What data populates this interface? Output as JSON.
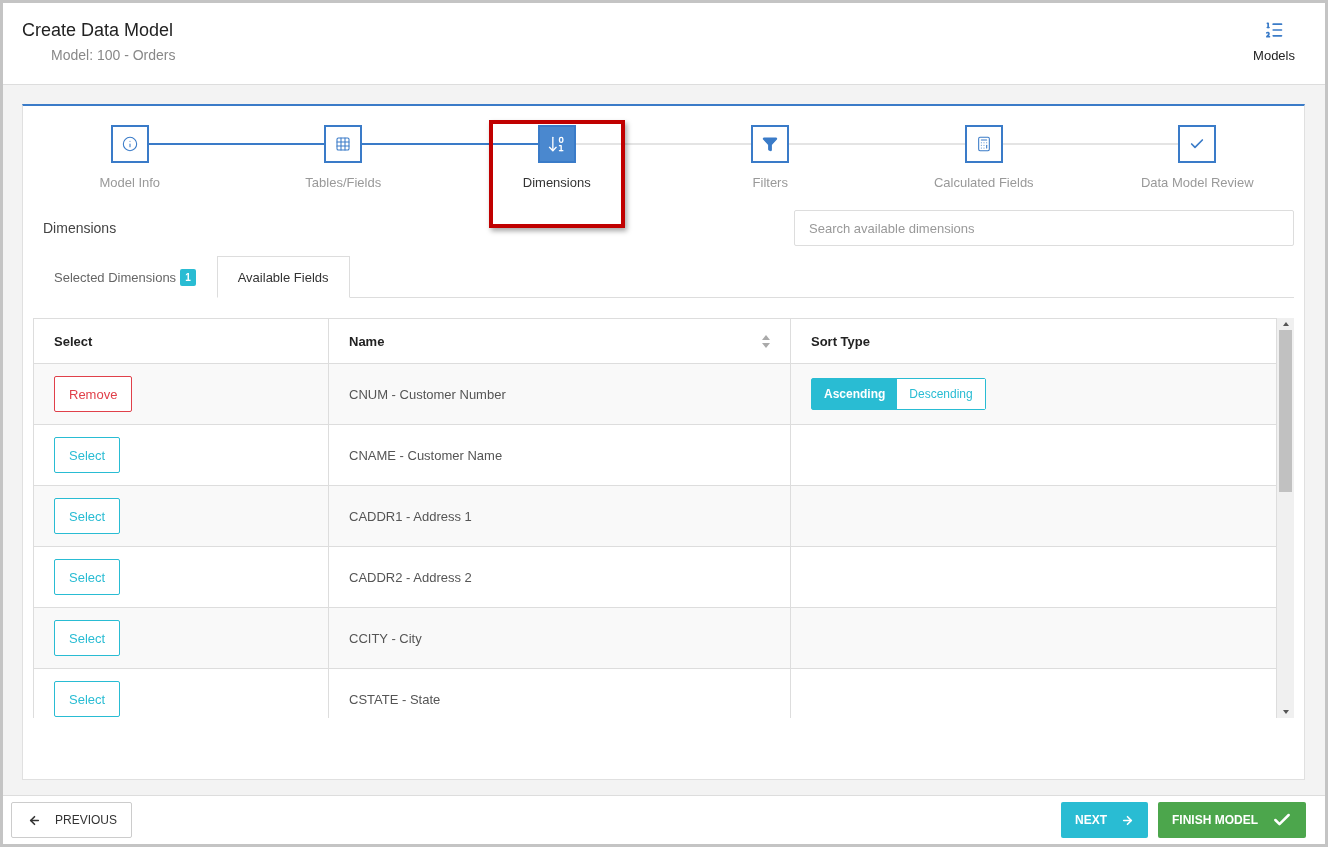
{
  "header": {
    "title": "Create Data Model",
    "subtitle": "Model: 100 - Orders",
    "models_label": "Models"
  },
  "steps": [
    {
      "label": "Model Info",
      "selected": false,
      "highlighted": false
    },
    {
      "label": "Tables/Fields",
      "selected": false,
      "highlighted": false
    },
    {
      "label": "Dimensions",
      "selected": true,
      "highlighted": true
    },
    {
      "label": "Filters",
      "selected": false,
      "highlighted": false
    },
    {
      "label": "Calculated Fields",
      "selected": false,
      "highlighted": false
    },
    {
      "label": "Data Model Review",
      "selected": false,
      "highlighted": false
    }
  ],
  "section_title": "Dimensions",
  "search": {
    "placeholder": "Search available dimensions"
  },
  "tabs": [
    {
      "label": "Selected Dimensions",
      "badge": "1",
      "selected": false
    },
    {
      "label": "Available Fields",
      "selected": true
    }
  ],
  "table": {
    "columns": [
      "Select",
      "Name",
      "Sort Type"
    ],
    "rows": [
      {
        "action": "Remove",
        "kind": "remove",
        "name": "CNUM - Customer Number",
        "sort_options": [
          {
            "label": "Ascending",
            "selected": true
          },
          {
            "label": "Descending",
            "selected": false
          }
        ]
      },
      {
        "action": "Select",
        "kind": "select",
        "name": "CNAME - Customer Name"
      },
      {
        "action": "Select",
        "kind": "select",
        "name": "CADDR1 - Address 1"
      },
      {
        "action": "Select",
        "kind": "select",
        "name": "CADDR2 - Address 2"
      },
      {
        "action": "Select",
        "kind": "select",
        "name": "CCITY - City"
      },
      {
        "action": "Select",
        "kind": "select",
        "name": "CSTATE - State"
      }
    ]
  },
  "footer": {
    "previous": "PREVIOUS",
    "next": "NEXT",
    "finish": "FINISH MODEL"
  }
}
